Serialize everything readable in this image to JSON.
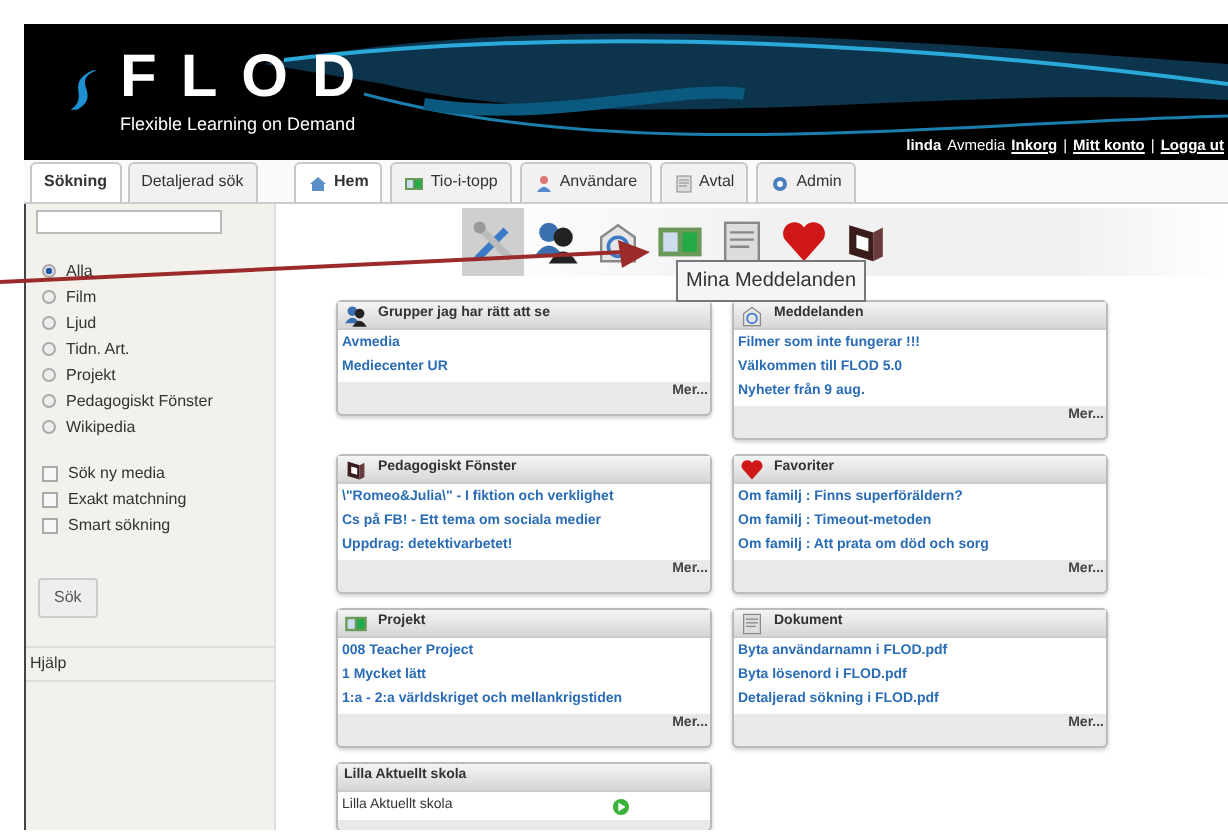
{
  "header": {
    "logo": "FLOD",
    "tagline": "Flexible Learning on Demand",
    "user": "linda",
    "organisation": "Avmedia",
    "links": [
      "Inkorg",
      "Mitt konto",
      "Logga ut"
    ],
    "separator": "|"
  },
  "side_tabs": [
    {
      "label": "Sökning",
      "selected": true
    },
    {
      "label": "Detaljerad sök",
      "selected": false
    }
  ],
  "main_tabs": [
    {
      "label": "Hem",
      "kind": "house",
      "selected": true
    },
    {
      "label": "Tio-i-topp",
      "kind": "film",
      "selected": false
    },
    {
      "label": "Användare",
      "kind": "person",
      "selected": false
    },
    {
      "label": "Avtal",
      "kind": "document",
      "selected": false
    },
    {
      "label": "Admin",
      "kind": "gear",
      "selected": false
    }
  ],
  "search": {
    "media_types": [
      {
        "label": "Alla",
        "selected": true
      },
      {
        "label": "Film",
        "selected": false
      },
      {
        "label": "Ljud",
        "selected": false
      },
      {
        "label": "Tidn. Art.",
        "selected": false
      },
      {
        "label": "Projekt",
        "selected": false
      },
      {
        "label": "Pedagogiskt Fönster",
        "selected": false
      },
      {
        "label": "Wikipedia",
        "selected": false
      }
    ],
    "options": [
      {
        "label": "Sök ny media",
        "checked": false
      },
      {
        "label": "Exakt matchning",
        "checked": false
      },
      {
        "label": "Smart sökning",
        "checked": false
      }
    ],
    "button": "Sök",
    "help": "Hjälp"
  },
  "toolbar": [
    {
      "kind": "tools",
      "selected": true
    },
    {
      "kind": "users",
      "selected": false
    },
    {
      "kind": "mail",
      "selected": false
    },
    {
      "kind": "film",
      "selected": false
    },
    {
      "kind": "document",
      "selected": false
    },
    {
      "kind": "heart",
      "selected": false
    },
    {
      "kind": "book",
      "selected": false
    }
  ],
  "tooltip": "Mina Meddelanden",
  "panels": [
    {
      "title": "Grupper jag har rätt att se",
      "kind": "users",
      "items": [
        "Avmedia",
        "Mediecenter UR"
      ],
      "more": "Mer..."
    },
    {
      "title": "Meddelanden",
      "kind": "mail",
      "items": [
        "Filmer som inte fungerar !!!",
        "Välkommen till FLOD 5.0",
        "Nyheter från 9 aug."
      ],
      "more": "Mer..."
    },
    {
      "title": "Pedagogiskt Fönster",
      "kind": "book",
      "items": [
        "\\\"Romeo&Julia\\\" - I fiktion och verklighet",
        "Cs på FB! - Ett tema om sociala medier",
        "Uppdrag: detektivarbetet!"
      ],
      "more": "Mer..."
    },
    {
      "title": "Favoriter",
      "kind": "heart",
      "items": [
        "Om familj : Finns superföräldern?",
        "Om familj : Timeout-metoden",
        "Om familj : Att prata om död och sorg"
      ],
      "more": "Mer..."
    },
    {
      "title": "Projekt",
      "kind": "film",
      "items": [
        "008 Teacher Project",
        "1 Mycket lätt",
        "1:a - 2:a världskriget och mellankrigstiden"
      ],
      "more": "Mer..."
    },
    {
      "title": "Dokument",
      "kind": "document",
      "items": [
        "Byta användarnamn i FLOD.pdf",
        "Byta lösenord i FLOD.pdf",
        "Detaljerad sökning i FLOD.pdf"
      ],
      "more": "Mer..."
    },
    {
      "title": "Lilla Aktuellt skola",
      "kind": "news",
      "items": [
        "Lilla Aktuellt skola"
      ]
    }
  ]
}
